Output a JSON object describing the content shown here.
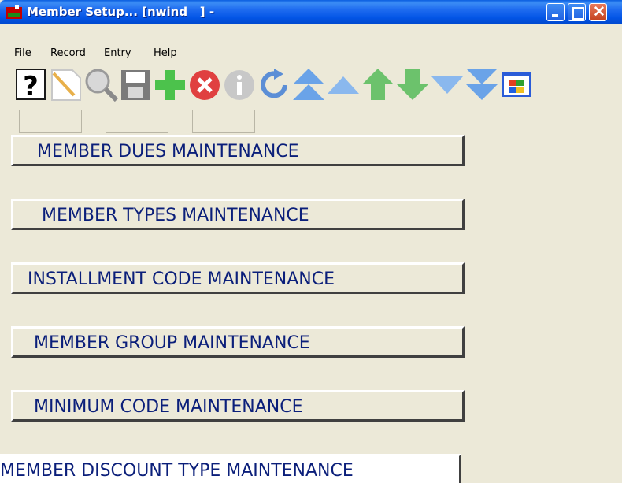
{
  "window": {
    "title": "Member Setup... [nwind   ] -"
  },
  "menu": {
    "items": [
      {
        "label": "File"
      },
      {
        "label": "Record"
      },
      {
        "label": "Entry"
      },
      {
        "label": "Help"
      }
    ]
  },
  "toolbar": {
    "icons": [
      "help-icon",
      "new-record-icon",
      "search-icon",
      "save-icon",
      "add-icon",
      "delete-icon",
      "info-icon",
      "refresh-icon",
      "first-record-icon",
      "previous-page-icon",
      "previous-record-icon",
      "next-record-icon",
      "next-page-icon",
      "last-record-icon",
      "windows-icon"
    ]
  },
  "main": {
    "buttons": [
      {
        "label": "MEMBER DUES MAINTENANCE"
      },
      {
        "label": "MEMBER TYPES MAINTENANCE"
      },
      {
        "label": "INSTALLMENT CODE MAINTENANCE"
      },
      {
        "label": "MEMBER GROUP MAINTENANCE"
      },
      {
        "label": "MINIMUM CODE MAINTENANCE"
      },
      {
        "label": "MEMBER DISCOUNT TYPE MAINTENANCE"
      }
    ]
  },
  "colors": {
    "title_bar": "#0355e6",
    "button_text": "#0b1f7a",
    "window_bg": "#ece9d8"
  }
}
